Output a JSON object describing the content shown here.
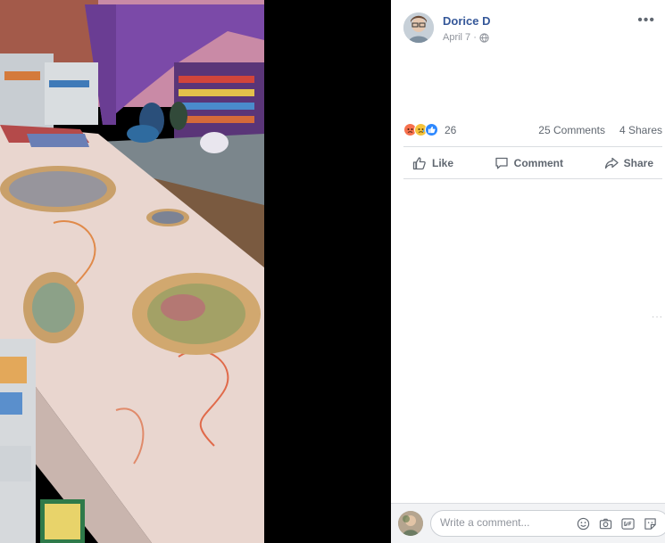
{
  "post": {
    "author": "Dorice D",
    "date": "April 7",
    "separator": "·",
    "more_label": "•••"
  },
  "reactions": {
    "count": "26",
    "comments": "25 Comments",
    "shares": "4 Shares",
    "icons": [
      "angry-icon",
      "sad-icon",
      "like-icon"
    ],
    "colors": {
      "angry": "#f7714e",
      "sad": "#f5c33b",
      "like": "#2d88ff"
    }
  },
  "actions": {
    "like": "Like",
    "comment": "Comment",
    "share": "Share"
  },
  "side_dots": "···",
  "comment_box": {
    "placeholder": "Write a comment...",
    "tools": [
      "emoji-icon",
      "camera-icon",
      "gif-icon",
      "sticker-icon"
    ]
  },
  "colors": {
    "author_link": "#365899",
    "muted": "#90949c",
    "action_text": "#606770",
    "divider": "#dadde1",
    "comment_bar_bg": "#f2f3f5"
  }
}
